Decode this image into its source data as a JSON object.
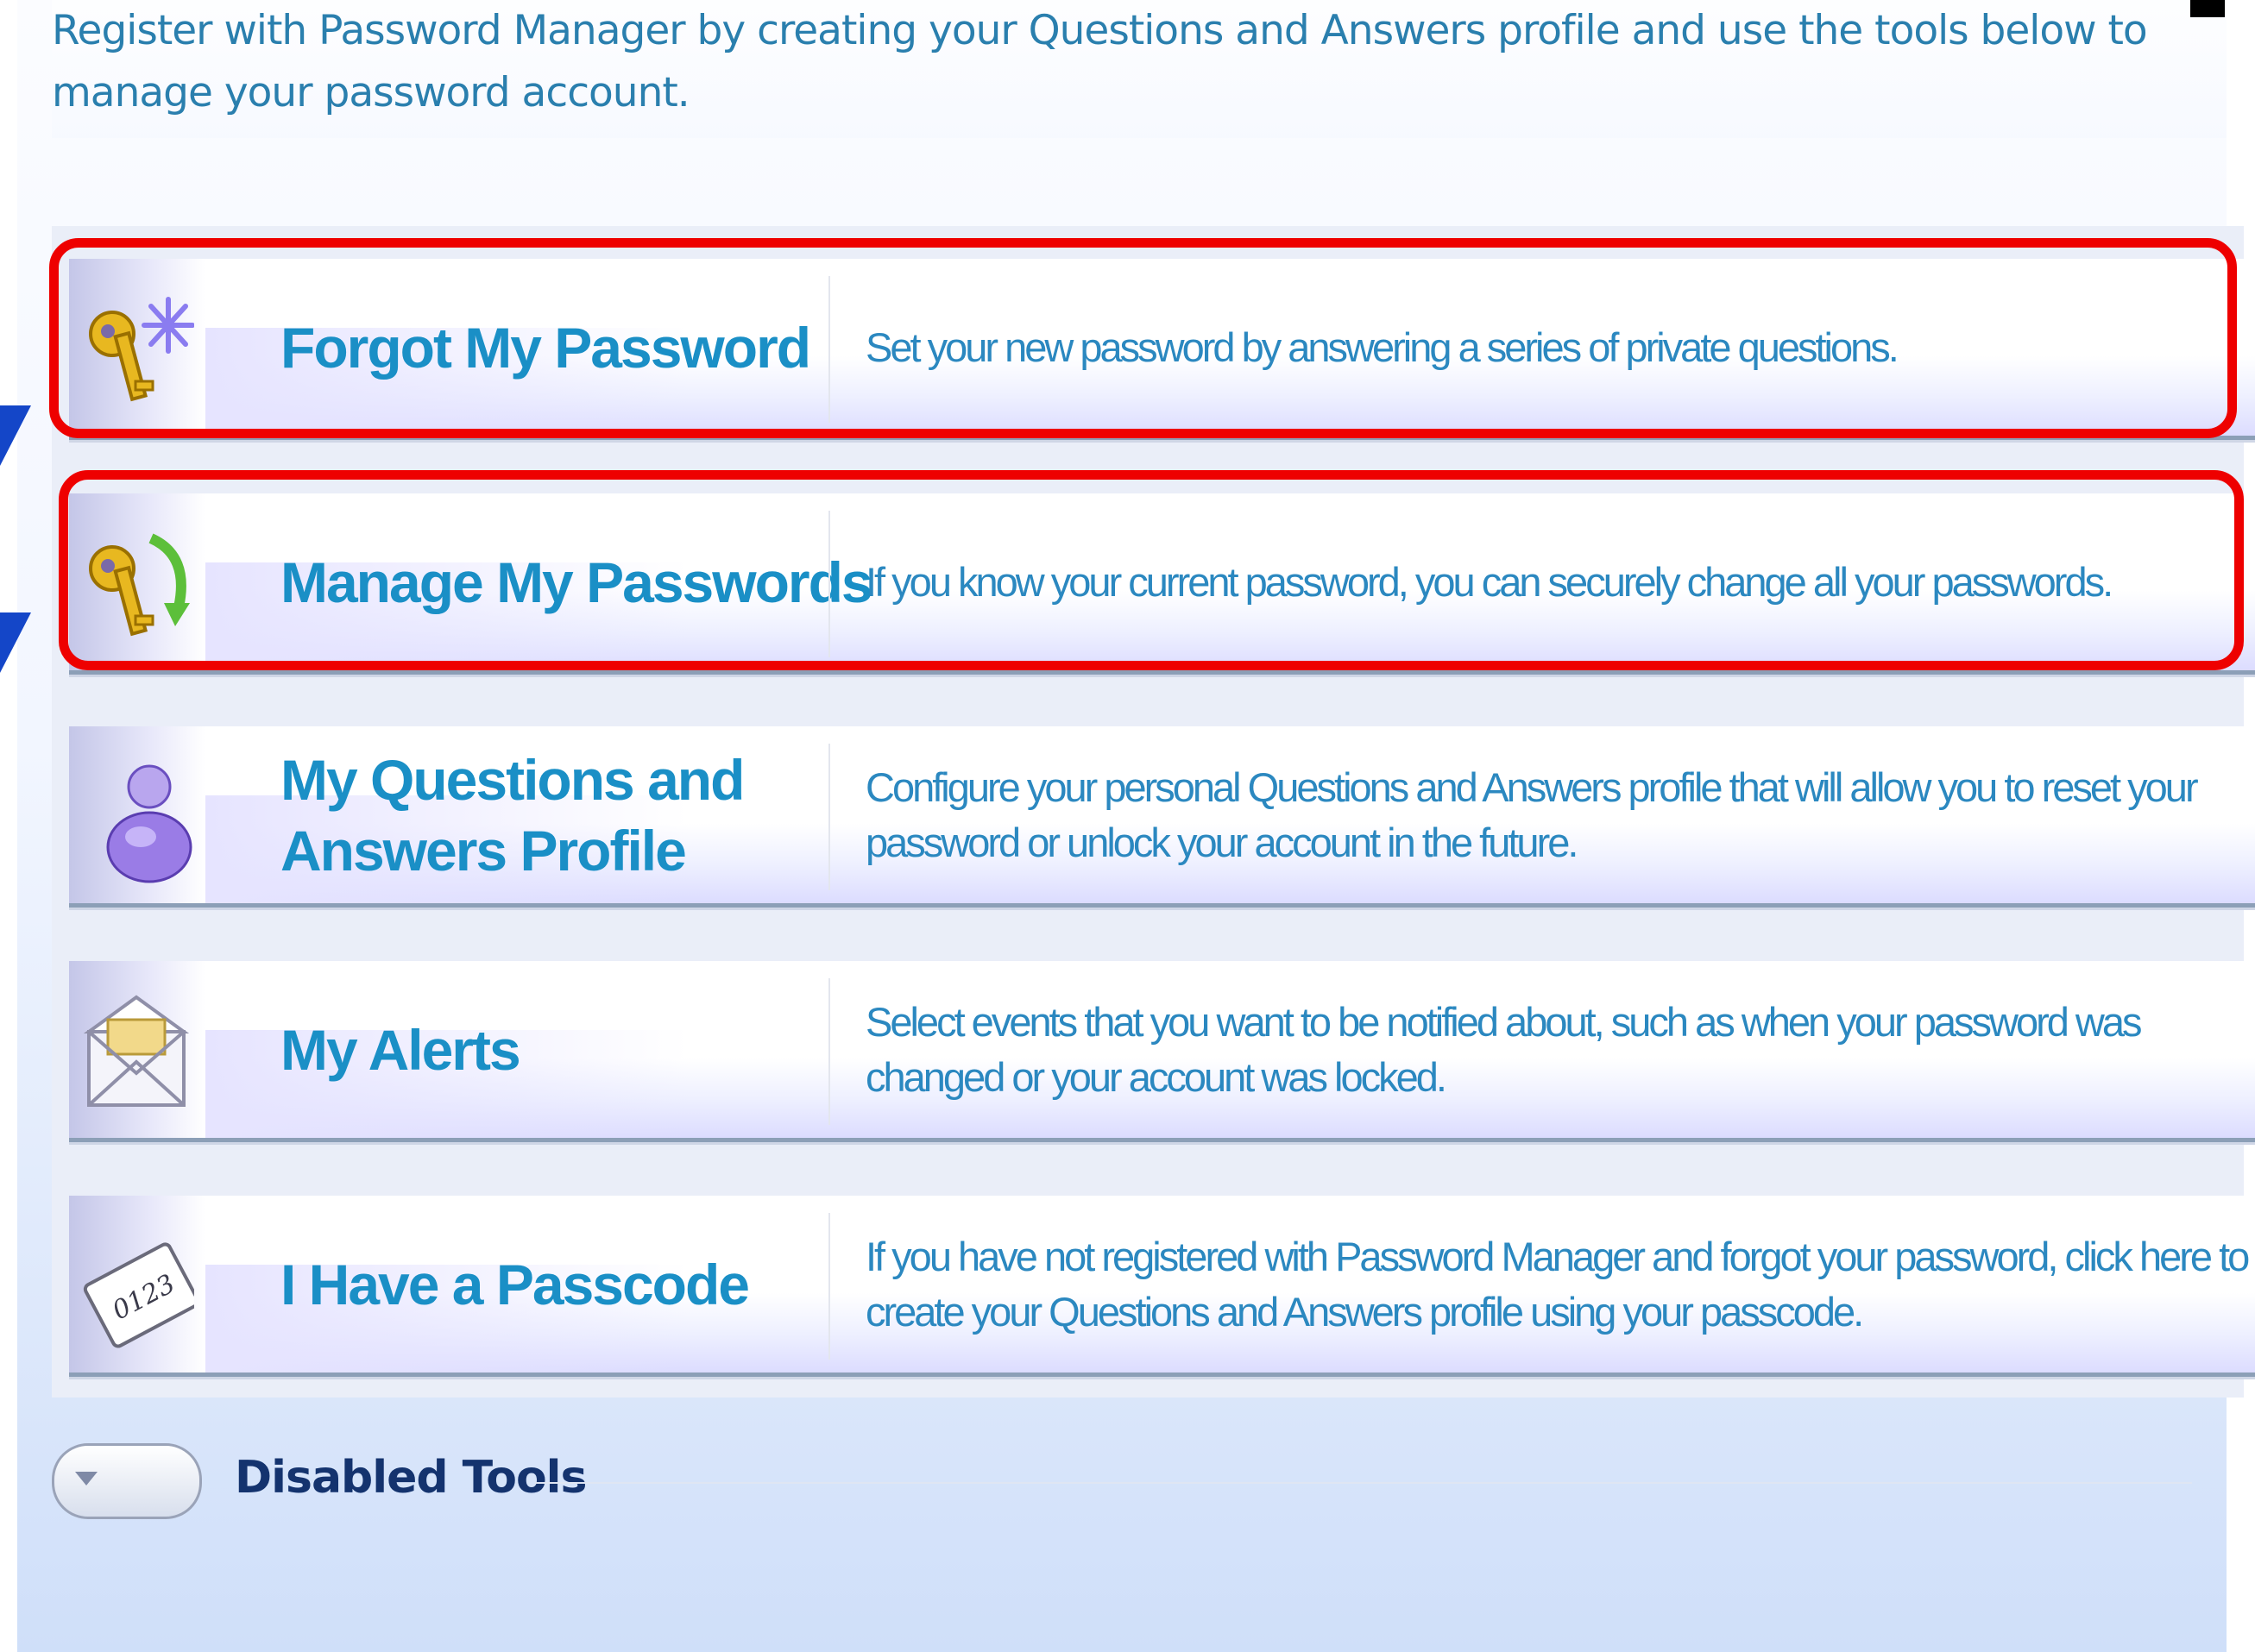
{
  "intro": {
    "text": "Register with Password Manager by creating your Questions and Answers profile and use the tools below to manage your password account."
  },
  "tools": [
    {
      "title": "Forgot My Password",
      "description": "Set your new password by answering a series of private questions.",
      "icon": "key-asterisk-icon"
    },
    {
      "title": "Manage My Passwords",
      "description": "If you know your current password, you can securely change all your passwords.",
      "icon": "key-refresh-icon"
    },
    {
      "title": "My Questions and Answers Profile",
      "description": "Configure your personal Questions and Answers profile that will allow you to reset your password or unlock your account in the future.",
      "icon": "user-profile-icon"
    },
    {
      "title": "My Alerts",
      "description": "Select events that you want to be notified about, such as when your password was changed or your account was locked.",
      "icon": "envelope-icon"
    },
    {
      "title": "I Have a Passcode",
      "description": "If you have not registered with Password Manager and forgot your password, click here to create your Questions and Answers profile using your passcode.",
      "icon": "passcode-card-icon",
      "icon_text": "0123"
    }
  ],
  "disabled_tools": {
    "label": "Disabled Tools",
    "icon": "chevron-down-icon"
  },
  "colors": {
    "title": "#1a8fc6",
    "description": "#2b88c0",
    "highlight": "#ee0000",
    "arrow": "#1446c8",
    "disabled_label": "#14336e"
  }
}
